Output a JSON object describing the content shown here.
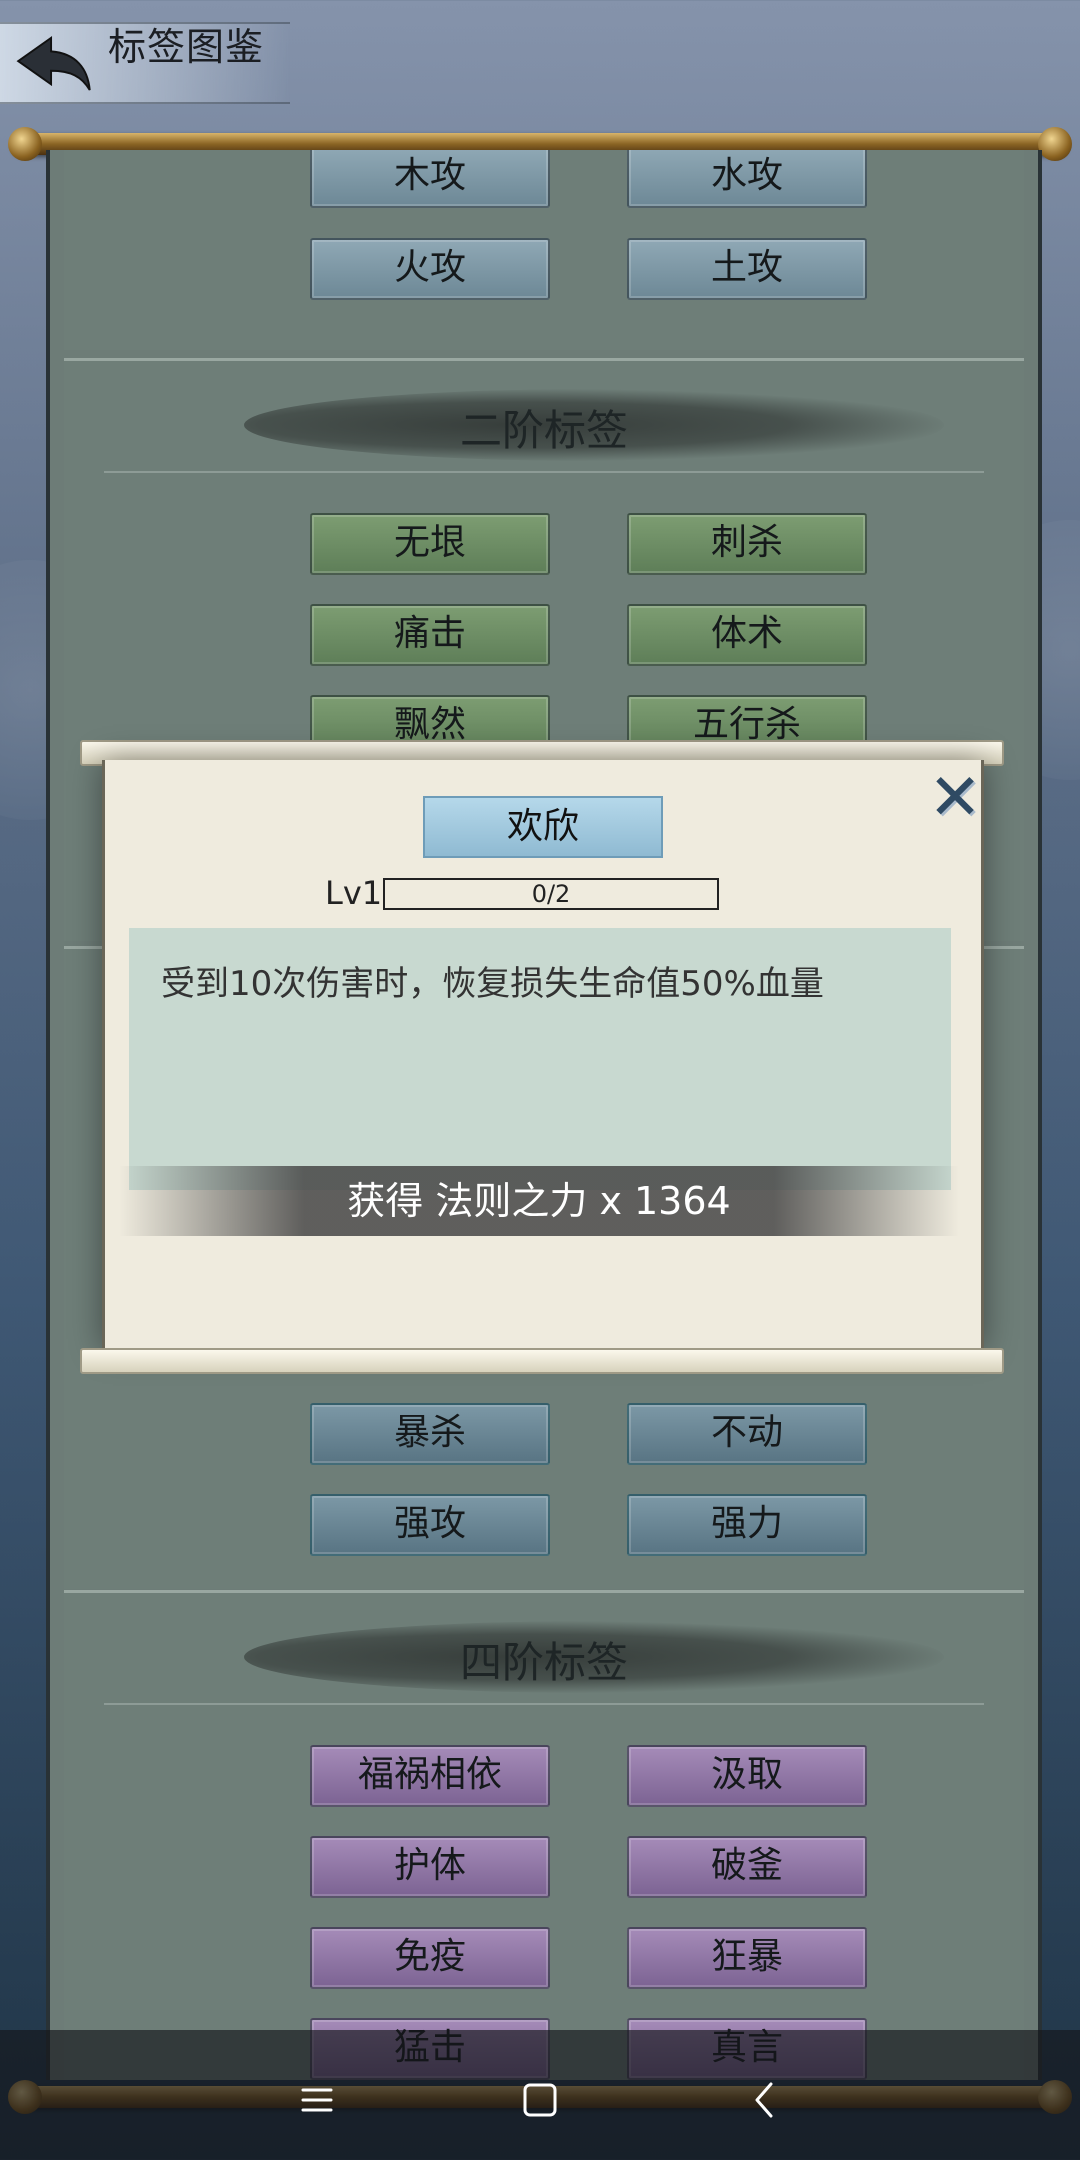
{
  "header": {
    "title": "标签图鉴"
  },
  "sections": {
    "tier1": {
      "tags": [
        "木攻",
        "水攻",
        "火攻",
        "土攻"
      ]
    },
    "tier2": {
      "title": "二阶标签",
      "tags": [
        "无垠",
        "刺杀",
        "痛击",
        "体术",
        "飘然",
        "五行杀"
      ]
    },
    "tier3": {
      "tags": [
        "暴杀",
        "不动",
        "强攻",
        "强力"
      ]
    },
    "tier4": {
      "title": "四阶标签",
      "tags": [
        "福祸相依",
        "汲取",
        "护体",
        "破釜",
        "免疫",
        "狂暴",
        "猛击",
        "真言"
      ]
    }
  },
  "modal": {
    "tag_name": "欢欣",
    "level": "Lv1",
    "progress_text": "0/2",
    "progress_fraction": 0,
    "description": "受到10次伤害时，恢复损失生命值50%血量",
    "reward": "获得 法则之力 x 1364"
  },
  "navbar": {
    "icons": [
      "menu-icon",
      "home-icon",
      "back-icon"
    ]
  }
}
